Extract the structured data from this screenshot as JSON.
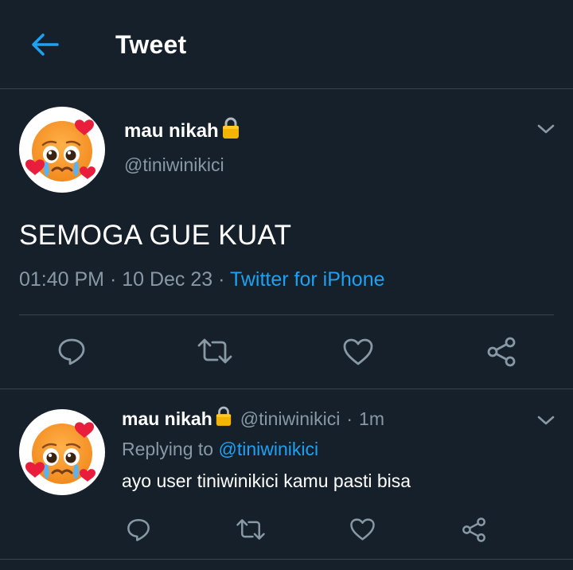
{
  "header": {
    "title": "Tweet",
    "back_icon": "arrow-left-icon"
  },
  "colors": {
    "background": "#15202b",
    "accent": "#1da1f2",
    "secondary_text": "#8899a6",
    "divider": "#38444d"
  },
  "main_tweet": {
    "author_name": "mau nikah",
    "lock_icon": "lock-icon",
    "handle": "@tiniwinikici",
    "avatar": "pleading-face-hearts-emoji",
    "text": "SEMOGA GUE KUAT",
    "timestamp": "01:40 PM · 10 Dec 23 · ",
    "source": "Twitter for iPhone",
    "actions": [
      "reply-icon",
      "retweet-icon",
      "like-icon",
      "share-icon"
    ]
  },
  "reply_tweet": {
    "author_name": "mau nikah",
    "handle": "@tiniwinikici",
    "separator": "·",
    "time": "1m",
    "replying_prefix": "Replying to ",
    "replying_to": "@tiniwinikici",
    "text": "ayo user tiniwinikici kamu pasti bisa",
    "avatar": "pleading-face-hearts-emoji",
    "actions": [
      "reply-icon",
      "retweet-icon",
      "like-icon",
      "share-icon"
    ]
  }
}
